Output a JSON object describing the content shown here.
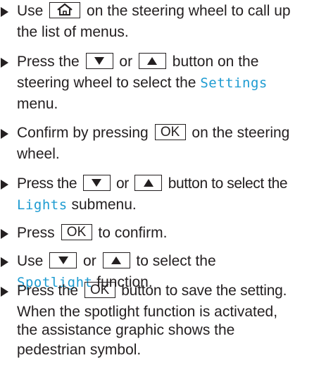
{
  "steps": [
    {
      "lines": [
        {
          "pre": "Use",
          "key": "home",
          "post": "on the steering wheel to call up"
        },
        {
          "text": "the list of menus."
        }
      ]
    },
    {
      "lines": [
        {
          "pre": "Press the",
          "key1": "down",
          "mid": "or",
          "key2": "up",
          "post": "button on the"
        },
        {
          "pre": "steering wheel to select the",
          "menu": "Settings"
        },
        {
          "text": "menu."
        }
      ]
    },
    {
      "lines": [
        {
          "pre": "Confirm by pressing",
          "key": "OK",
          "post": "on the steering"
        },
        {
          "text": "wheel."
        }
      ]
    },
    {
      "lines": [
        {
          "pre": "Press the",
          "mid": "or",
          "post": "button to select the"
        },
        {
          "menu": "Lights",
          "post": "submenu."
        }
      ]
    },
    {
      "lines": [
        {
          "pre": "Press",
          "key": "OK",
          "post": "to confirm."
        }
      ]
    },
    {
      "lines": [
        {
          "pre": "Use",
          "mid": "or",
          "post": "to select the"
        },
        {
          "menu": "Spotlight",
          "post": "function."
        }
      ]
    },
    {
      "lines": [
        {
          "pre": "Press the",
          "key": "OK",
          "post": "button to save the setting."
        },
        {
          "text": "When the spotlight function is activated,"
        },
        {
          "text": "the assistance graphic shows the"
        },
        {
          "text": "pedestrian symbol."
        }
      ]
    }
  ],
  "icons": {
    "bullet": "right-triangle-bullet-icon",
    "home": "home-icon",
    "down": "down-triangle-icon",
    "up": "up-triangle-icon"
  },
  "colors": {
    "text": "#231f20",
    "menu_highlight": "#1d9bd1"
  }
}
